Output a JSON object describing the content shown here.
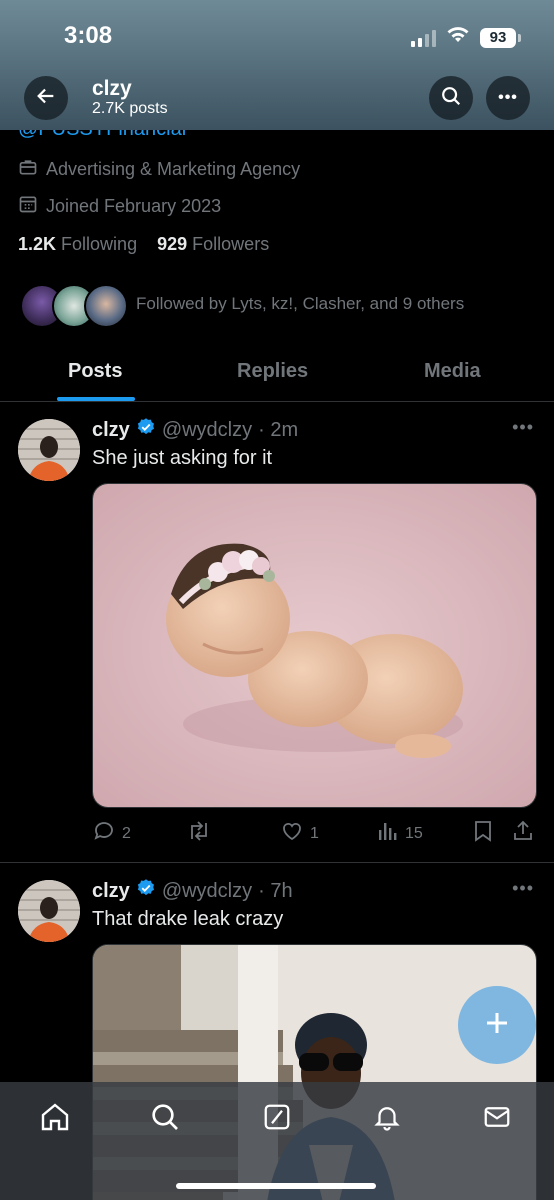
{
  "status": {
    "time": "3:08",
    "battery": "93"
  },
  "header": {
    "name": "clzy",
    "posts_count": "2.7K posts"
  },
  "profile": {
    "handle_partial": "@PUSSYFinancial",
    "category": "Advertising & Marketing Agency",
    "joined": "Joined February 2023",
    "following_count": "1.2K",
    "following_label": "Following",
    "followers_count": "929",
    "followers_label": "Followers",
    "followed_by": "Followed by Lyts, kz!, Clasher, and 9 others"
  },
  "tabs": [
    {
      "label": "Posts"
    },
    {
      "label": "Replies"
    },
    {
      "label": "Media"
    }
  ],
  "posts": [
    {
      "name": "clzy",
      "handle": "@wydclzy",
      "time": "· 2m",
      "text": "She just asking for it",
      "replies": "2",
      "reposts": "",
      "likes": "1",
      "views": "15"
    },
    {
      "name": "clzy",
      "handle": "@wydclzy",
      "time": "· 7h",
      "text": "That drake leak crazy"
    }
  ],
  "colors": {
    "accent": "#1d9bf0",
    "verified": "#1d9bf0",
    "muted": "#71767b",
    "fab": "#7fb7e0"
  },
  "icons": [
    "back-arrow-icon",
    "search-icon",
    "more-icon",
    "briefcase-icon",
    "calendar-icon",
    "verified-badge-icon",
    "reply-icon",
    "repost-icon",
    "like-icon",
    "views-icon",
    "bookmark-icon",
    "share-icon",
    "compose-plus-icon",
    "home-icon",
    "explore-icon",
    "grok-icon",
    "notifications-icon",
    "messages-icon"
  ]
}
